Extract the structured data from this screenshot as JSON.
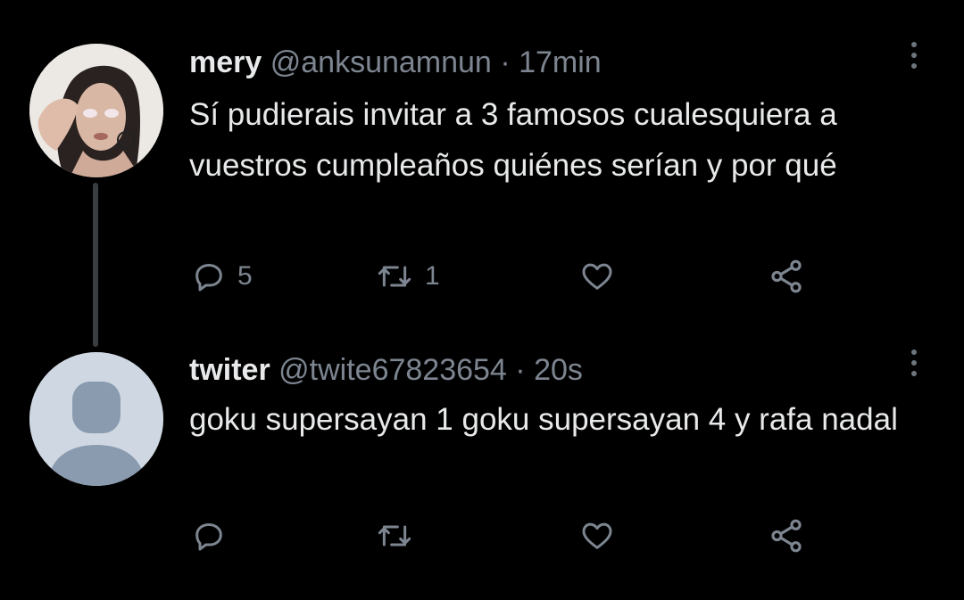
{
  "tweets": [
    {
      "author_name": "mery",
      "handle": "@anksunamnun",
      "separator": "·",
      "time": "17min",
      "text": "Sí pudierais invitar a 3 famosos cualesquiera a vuestros cumpleaños quiénes serían y por qué",
      "avatar": "profile-photo",
      "actions": {
        "reply_icon": "reply-icon",
        "reply_count": "5",
        "retweet_icon": "retweet-icon",
        "retweet_count": "1",
        "like_icon": "heart-icon",
        "like_count": "",
        "share_icon": "share-icon"
      }
    },
    {
      "author_name": "twiter",
      "handle": "@twite67823654",
      "separator": "·",
      "time": "20s",
      "text": "goku supersayan 1 goku supersayan 4 y rafa nadal",
      "avatar": "default-avatar",
      "actions": {
        "reply_icon": "reply-icon",
        "reply_count": "",
        "retweet_icon": "retweet-icon",
        "retweet_count": "",
        "like_icon": "heart-icon",
        "like_count": "",
        "share_icon": "share-icon"
      }
    }
  ],
  "colors": {
    "background": "#000000",
    "text_primary": "#e7e9ea",
    "text_secondary": "#7d8590",
    "thread_line": "#3a3d40",
    "default_avatar_bg": "#cfd8e2",
    "default_avatar_fg": "#8a9bb0"
  }
}
